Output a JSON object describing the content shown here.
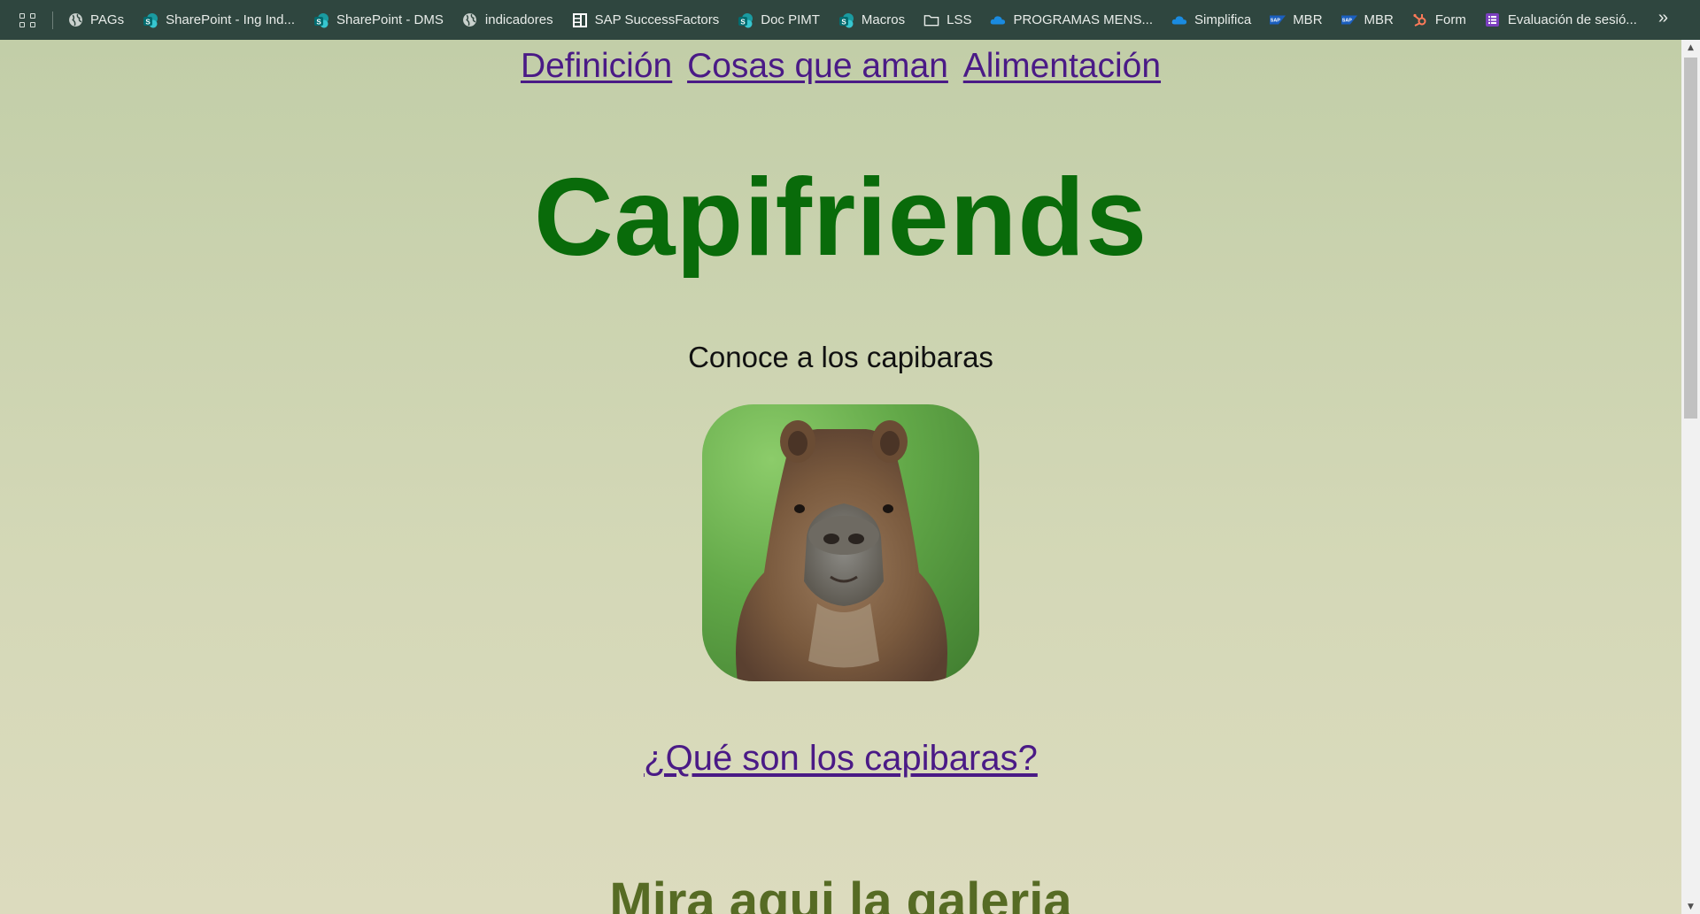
{
  "bookmarks": [
    {
      "label": "PAGs",
      "icon": "globe-icon"
    },
    {
      "label": "SharePoint - Ing Ind...",
      "icon": "sharepoint-icon"
    },
    {
      "label": "SharePoint - DMS",
      "icon": "sharepoint-icon"
    },
    {
      "label": "indicadores",
      "icon": "globe-icon"
    },
    {
      "label": "SAP SuccessFactors",
      "icon": "successfactors-icon"
    },
    {
      "label": "Doc PIMT",
      "icon": "sharepoint-icon"
    },
    {
      "label": "Macros",
      "icon": "sharepoint-icon"
    },
    {
      "label": "LSS",
      "icon": "folder-icon"
    },
    {
      "label": "PROGRAMAS MENS...",
      "icon": "onedrive-icon"
    },
    {
      "label": "Simplifica",
      "icon": "onedrive-icon"
    },
    {
      "label": "MBR",
      "icon": "sap-icon"
    },
    {
      "label": "MBR",
      "icon": "sap-icon"
    },
    {
      "label": "Form",
      "icon": "hubspot-icon"
    },
    {
      "label": "Evaluación de sesió...",
      "icon": "forms-icon"
    }
  ],
  "colors": {
    "toolbar_bg": "#2f463f",
    "page_bg_top": "#c2cea8",
    "page_bg_bottom": "#dcdbbe",
    "link": "#4a1a86",
    "title": "#096b0a",
    "gallery_heading": "#566b24"
  },
  "page": {
    "nav": [
      "Definición",
      "Cosas que aman",
      "Alimentación"
    ],
    "title": "Capifriends",
    "subtitle": "Conoce a los capibaras",
    "photo_link": "¿Qué son los capibaras?",
    "gallery_heading": "Mira aqui la galeria"
  }
}
